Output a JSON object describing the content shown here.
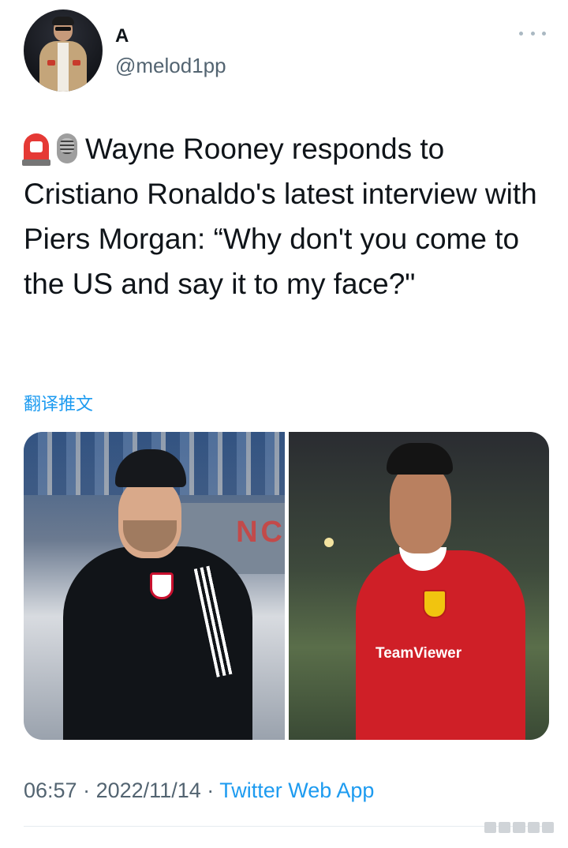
{
  "author": {
    "display_name": "A",
    "handle": "@melod1pp"
  },
  "tweet": {
    "text": "Wayne Rooney responds to Cristiano Ronaldo's latest interview with Piers Morgan: “Why don't you come to the US and say it to my face?\"",
    "emojis": [
      "rotating-light-emoji",
      "microphone-emoji"
    ],
    "translate_label": "翻译推文"
  },
  "media": {
    "left_sign_text": "NC",
    "right_sponsor_text": "TeamViewer"
  },
  "meta": {
    "time": "06:57",
    "separator": "·",
    "date": "2022/11/14",
    "source": "Twitter Web App"
  },
  "colors": {
    "link": "#1d9bf0",
    "secondary_text": "#536471"
  }
}
